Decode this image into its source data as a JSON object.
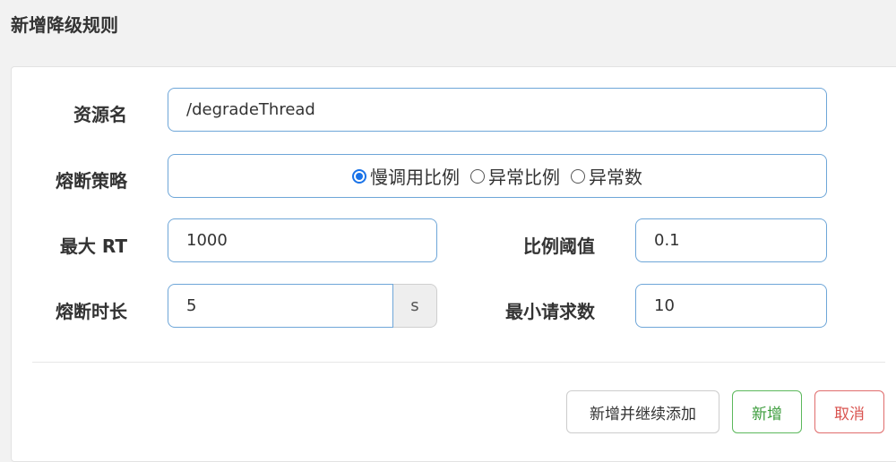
{
  "dialog": {
    "title": "新增降级规则"
  },
  "form": {
    "resource": {
      "label": "资源名",
      "value": "/degradeThread"
    },
    "strategy": {
      "label": "熔断策略",
      "options": [
        "慢调用比例",
        "异常比例",
        "异常数"
      ],
      "selected": "慢调用比例"
    },
    "max_rt": {
      "label": "最大 RT",
      "value": "1000"
    },
    "ratio_threshold": {
      "label": "比例阈值",
      "value": "0.1"
    },
    "break_duration": {
      "label": "熔断时长",
      "value": "5",
      "unit": "s"
    },
    "min_request": {
      "label": "最小请求数",
      "value": "10"
    }
  },
  "buttons": {
    "add_continue": "新增并继续添加",
    "add": "新增",
    "cancel": "取消"
  },
  "colors": {
    "input_border": "#6ea6d8",
    "radio_selected": "#1a73e8",
    "success": "#5cb85c",
    "danger": "#d9534f"
  },
  "icons": [
    "radio-selected-icon",
    "radio-unselected-icon"
  ]
}
